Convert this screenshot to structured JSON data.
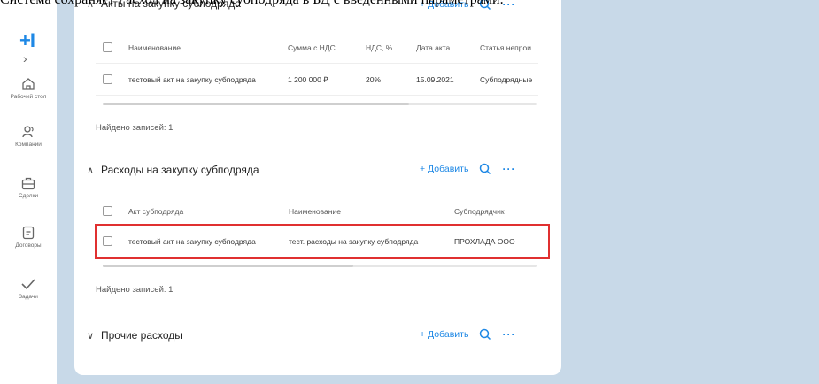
{
  "caption": "Система сохраняет Расход на закупку субподряда в БД с введенными параметрами.",
  "sidebar": {
    "logo": "+I",
    "expand": "›",
    "items": [
      {
        "label": "Рабочий стол",
        "icon": "home-icon"
      },
      {
        "label": "Компании",
        "icon": "people-icon"
      },
      {
        "label": "Сделки",
        "icon": "briefcase-icon"
      },
      {
        "label": "Договоры",
        "icon": "document-icon"
      },
      {
        "label": "Задачи",
        "icon": "check-icon"
      }
    ]
  },
  "colors": {
    "accent": "#1e88e5",
    "background": "#c8d9e8",
    "highlight": "#e03030"
  },
  "sections": {
    "acts": {
      "title": "Акты на закупку субподряда",
      "add_label": "+ Добавить",
      "columns": [
        "Наименование",
        "Сумма с НДС",
        "НДС, %",
        "Дата акта",
        "Статья непрои"
      ],
      "rows": [
        [
          "тестовый акт на закупку субподряда",
          "1 200 000 ₽",
          "20%",
          "15.09.2021",
          "Субподрядные"
        ]
      ],
      "found": "Найдено записей: 1"
    },
    "expenses": {
      "title": "Расходы на закупку субподряда",
      "add_label": "+ Добавить",
      "columns": [
        "Акт субподряда",
        "Наименование",
        "Субподрядчик"
      ],
      "rows": [
        [
          "тестовый акт на закупку субподряда",
          "тест. расходы на закупку субподряда",
          "ПРОХЛАДА ООО"
        ]
      ],
      "found": "Найдено записей: 1"
    },
    "other": {
      "title": "Прочие расходы",
      "add_label": "+ Добавить"
    }
  }
}
